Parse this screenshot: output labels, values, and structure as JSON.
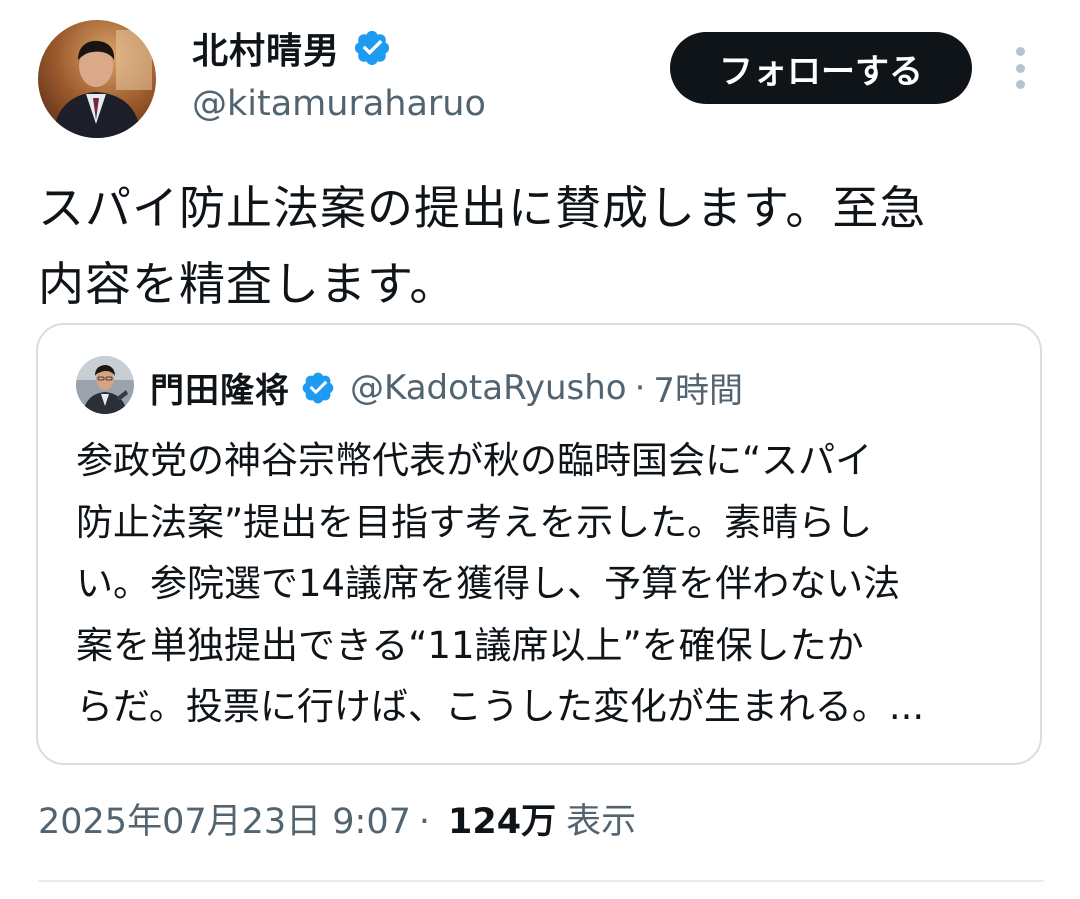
{
  "tweet": {
    "author": {
      "display_name": "北村晴男",
      "handle": "@kitamuraharuo",
      "verified": true
    },
    "follow_label": "フォローする",
    "text_lines": [
      "スパイ防止法案の提出に賛成します。至急",
      "内容を精査します。"
    ],
    "quoted": {
      "display_name": "門田隆将",
      "handle": "@KadotaRyusho",
      "separator": "·",
      "time_ago": "7時間",
      "text_lines": [
        "参政党の神谷宗幣代表が秋の臨時国会に“スパイ",
        "防止法案”提出を目指す考えを示した。素晴らし",
        "い。参院選で14議席を獲得し、予算を伴わない法",
        "案を単独提出できる“11議席以上”を確保したか",
        "らだ。投票に行けば、こうした変化が生まれる。..."
      ]
    },
    "timestamp": "2025年07月23日 9:07",
    "separator": "·",
    "views_count": "124万",
    "views_label": "表示"
  },
  "colors": {
    "text_primary": "#0f1419",
    "text_secondary": "#536471",
    "verified_badge": "#1d9bf0",
    "follow_button_bg": "#0f1419",
    "border": "#d6dde3"
  },
  "icons": {
    "verified": "verified-badge-icon",
    "more": "more-options-icon"
  }
}
